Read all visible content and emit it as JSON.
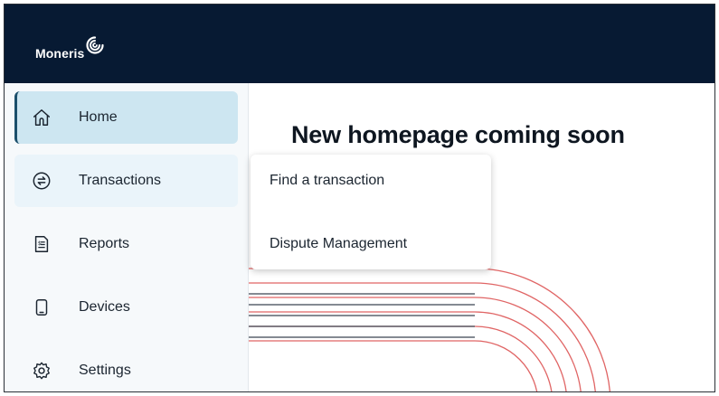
{
  "brand": {
    "name": "Moneris",
    "color": "#071a33",
    "accent": "#cde6f1"
  },
  "sidebar": {
    "items": [
      {
        "label": "Home",
        "icon": "home-icon",
        "state": "active"
      },
      {
        "label": "Transactions",
        "icon": "exchange-icon",
        "state": "hover"
      },
      {
        "label": "Reports",
        "icon": "report-icon",
        "state": "normal"
      },
      {
        "label": "Devices",
        "icon": "device-icon",
        "state": "normal"
      },
      {
        "label": "Settings",
        "icon": "gear-icon",
        "state": "normal"
      }
    ]
  },
  "main": {
    "title": "New homepage coming soon"
  },
  "flyout": {
    "items": [
      {
        "label": "Find a transaction"
      },
      {
        "label": "Dispute Management"
      }
    ]
  }
}
